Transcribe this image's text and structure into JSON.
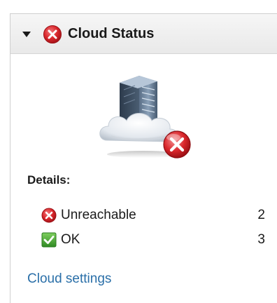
{
  "panel": {
    "title": "Cloud Status",
    "status": "error",
    "collapse_icon": "caret-down-icon",
    "header_icon": "error-icon",
    "hero_icon": "cloud-server-error-icon"
  },
  "details": {
    "heading": "Details:",
    "rows": [
      {
        "icon": "error-icon",
        "label": "Unreachable",
        "count": "2"
      },
      {
        "icon": "check-icon",
        "label": "OK",
        "count": "3"
      }
    ]
  },
  "settings_link": "Cloud settings",
  "colors": {
    "error": "#d9262b",
    "ok": "#3f9b2f",
    "link": "#2a6fa8",
    "header_bg": "#eeeeee",
    "border": "#cfcfcf"
  }
}
